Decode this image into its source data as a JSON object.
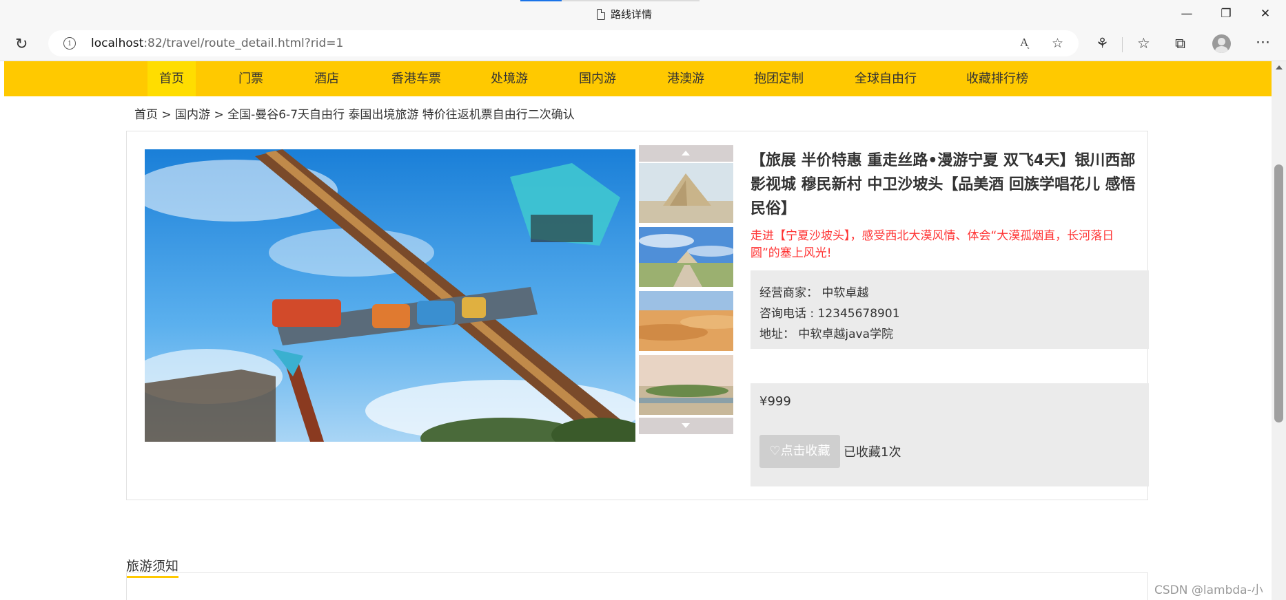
{
  "browser": {
    "tab_title": "路线详情",
    "url_host": "localhost",
    "url_rest": ":82/travel/route_detail.html?rid=1"
  },
  "nav": {
    "items": [
      "首页",
      "门票",
      "酒店",
      "香港车票",
      "处境游",
      "国内游",
      "港澳游",
      "抱团定制",
      "全球自由行",
      "收藏排行榜"
    ],
    "active": "首页"
  },
  "breadcrumb": "首页 > 国内游 > 全国-曼谷6-7天自由行 泰国出境旅游 特价往返机票自由行二次确认",
  "route": {
    "title": "【旅展 半价特惠 重走丝路•漫游宁夏 双飞4天】银川西部影视城 穆民新村 中卫沙坡头【品美酒 回族学唱花儿 感悟民俗】",
    "intro": "走进【宁夏沙坡头】，感受西北大漠风情、体会“大漠孤烟直，长河落日圆”的塞上风光!",
    "seller": "经营商家： 中软卓越",
    "phone": "咨询电话 : 12345678901",
    "address": "地址： 中软卓越java学院",
    "price": "¥999",
    "favorite_button": "点击收藏",
    "favorite_count": "已收藏1次"
  },
  "notice_tab": "旅游须知",
  "watermark": "CSDN @lambda-小张",
  "colors": {
    "nav_bg": "#ffc900",
    "nav_active": "#ffdd00",
    "intro_red": "#ff3333",
    "info_bg": "#ebebeb"
  }
}
